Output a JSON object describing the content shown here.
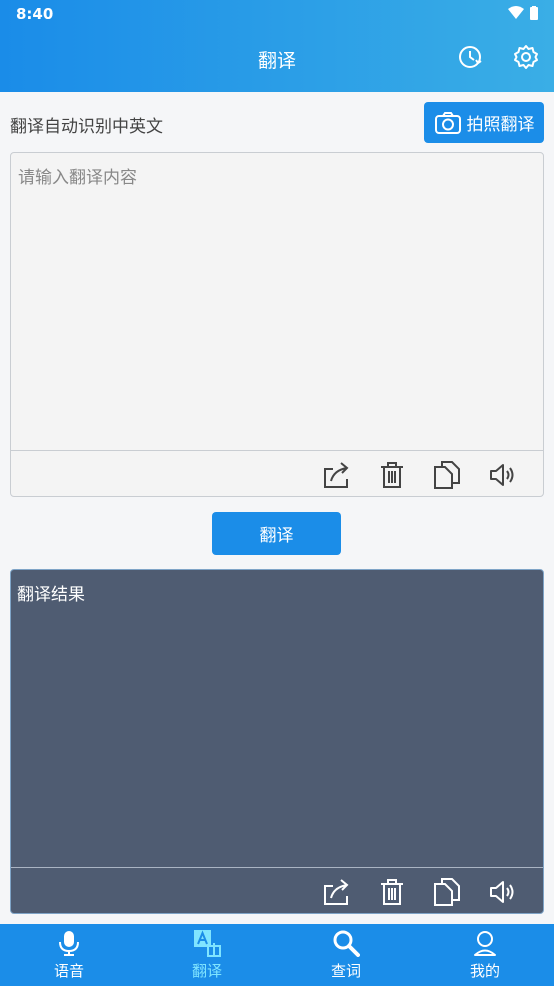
{
  "status_bar": {
    "time": "8:40"
  },
  "header": {
    "title": "翻译"
  },
  "hint": "翻译自动识别中英文",
  "photo_button": {
    "label": "拍照翻译"
  },
  "input": {
    "placeholder": "请输入翻译内容"
  },
  "translate_button": {
    "label": "翻译"
  },
  "result": {
    "label": "翻译结果"
  },
  "tabs": [
    {
      "label": "语音",
      "icon": "mic-icon"
    },
    {
      "label": "翻译",
      "icon": "translate-icon",
      "active": true
    },
    {
      "label": "查词",
      "icon": "search-icon"
    },
    {
      "label": "我的",
      "icon": "user-icon"
    }
  ],
  "colors": {
    "primary": "#1b8de8",
    "result_bg": "#4f5c72",
    "active_tab": "#7fe4ff"
  }
}
